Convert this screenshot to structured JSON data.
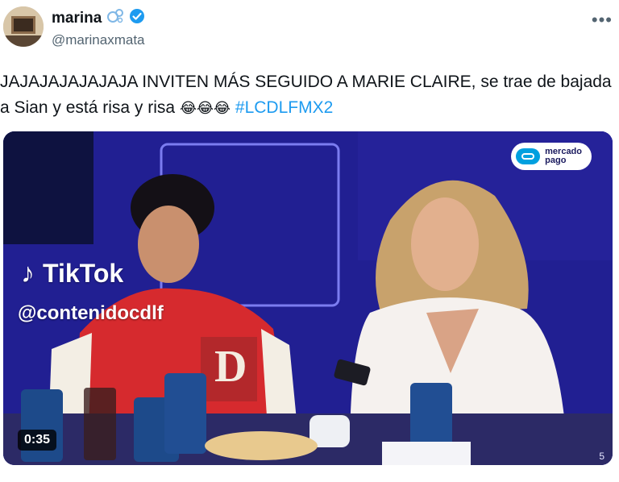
{
  "author": {
    "name": "marina",
    "handle": "@marinaxmata",
    "name_emoji_icon": "bubbles-icon",
    "verified_icon": "verified-badge-icon"
  },
  "tweet": {
    "text": "JAJAJAJAJAJAJA INVITEN MÁS SEGUIDO A MARIE CLAIRE, se trae de bajada a Sian y está risa y risa",
    "emojis": "😂😂😂",
    "hashtag": "#LCDLFMX2"
  },
  "media": {
    "sponsor_line1": "mercado",
    "sponsor_line2": "pago",
    "watermark_brand": "TikTok",
    "watermark_user": "@contenidocdlf",
    "duration": "0:35",
    "corner_mark": "5"
  },
  "colors": {
    "link": "#1d9bf0",
    "background": "#1b1a8a",
    "verified": "#1d9bf0"
  }
}
